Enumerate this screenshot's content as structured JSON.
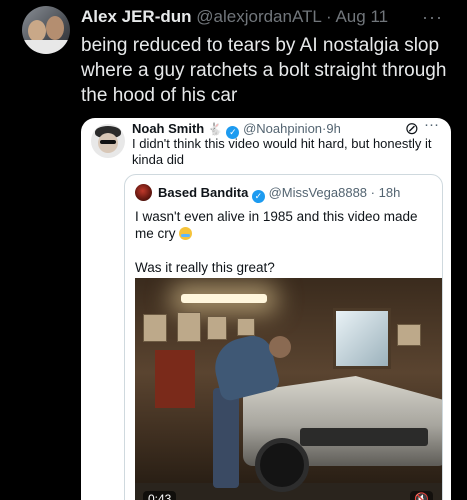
{
  "tweet": {
    "display_name": "Alex JER-dun",
    "handle": "@alexjordanATL",
    "separator": "·",
    "date": "Aug 11",
    "more": "···",
    "text": "being reduced to tears by AI nostalgia slop where a guy ratchets a bolt straight through the hood of his car"
  },
  "quoted": {
    "display_name": "Noah Smith",
    "rabbit": "🐇",
    "handle": "@Noahpinion",
    "separator": "·",
    "time": "9h",
    "text": "I didn't think this video would hit hard, but honestly it kinda did",
    "inner": {
      "display_name": "Based Bandita",
      "handle": "@MissVega8888",
      "separator": "·",
      "time": "18h",
      "line1": "I wasn't even alive in 1985 and this video made me cry",
      "line2": "Was it really this great?",
      "video": {
        "duration": "0:43",
        "mute": "🔇"
      }
    }
  },
  "colors": {
    "background": "#000000",
    "text_primary": "#e7e9ea",
    "text_muted": "#71767b",
    "verified_blue": "#1d9bf0"
  }
}
